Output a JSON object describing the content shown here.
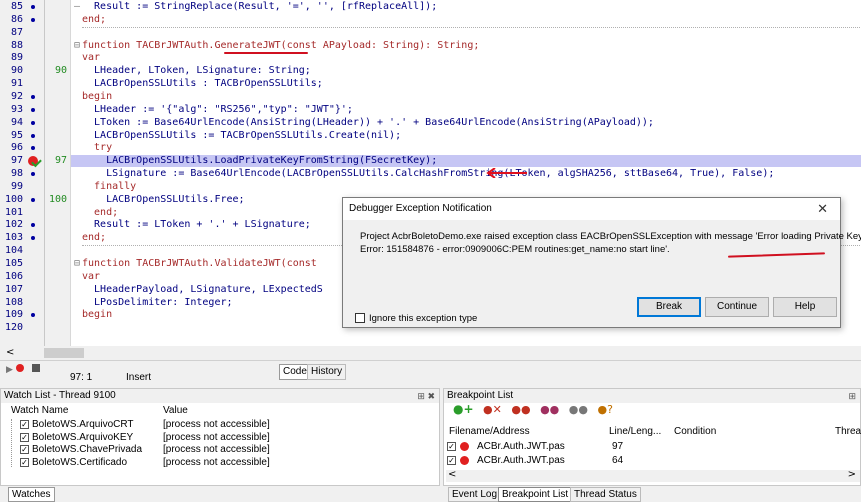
{
  "editor": {
    "lines": [
      {
        "num": "85",
        "bp": true,
        "fold": "–",
        "code": "  Result := StringReplace(Result, '=', '', [rfReplaceAll]);"
      },
      {
        "num": "86",
        "bp": true,
        "fold": "",
        "code": "end;"
      },
      {
        "num": "87",
        "bp": false,
        "fold": "",
        "code": ""
      },
      {
        "num": "88",
        "bp": false,
        "fold": "⊟",
        "code": "function TACBrJWTAuth.GenerateJWT(const APayload: String): String;"
      },
      {
        "num": "89",
        "bp": false,
        "fold": "",
        "code": "var"
      },
      {
        "num": "90",
        "bp": false,
        "fold": "",
        "code": "  LHeader, LToken, LSignature: String;",
        "num2": "90"
      },
      {
        "num": "91",
        "bp": false,
        "fold": "",
        "code": "  LACBrOpenSSLUtils : TACBrOpenSSLUtils;"
      },
      {
        "num": "92",
        "bp": true,
        "fold": "",
        "code": "begin"
      },
      {
        "num": "93",
        "bp": true,
        "fold": "",
        "code": "  LHeader := '{\"alg\": \"RS256\",\"typ\": \"JWT\"}';"
      },
      {
        "num": "94",
        "bp": true,
        "fold": "",
        "code": "  LToken := Base64UrlEncode(AnsiString(LHeader)) + '.' + Base64UrlEncode(AnsiString(APayload));"
      },
      {
        "num": "95",
        "bp": true,
        "fold": "",
        "code": "  LACBrOpenSSLUtils := TACBrOpenSSLUtils.Create(nil);"
      },
      {
        "num": "96",
        "bp": true,
        "fold": "",
        "code": "  try"
      },
      {
        "num": "97",
        "bp": false,
        "fold": "",
        "code": "    LACBrOpenSSLUtils.LoadPrivateKeyFromString(FSecretKey);",
        "num2": "97",
        "current": true
      },
      {
        "num": "98",
        "bp": true,
        "fold": "",
        "code": "    LSignature := Base64UrlEncode(LACBrOpenSSLUtils.CalcHashFromString(LToken, algSHA256, sttBase64, True), False);"
      },
      {
        "num": "99",
        "bp": false,
        "fold": "",
        "code": "  finally"
      },
      {
        "num": "100",
        "bp": true,
        "fold": "",
        "code": "    LACBrOpenSSLUtils.Free;",
        "num2": "100"
      },
      {
        "num": "101",
        "bp": false,
        "fold": "",
        "code": "  end;"
      },
      {
        "num": "102",
        "bp": true,
        "fold": "",
        "code": "  Result := LToken + '.' + LSignature;"
      },
      {
        "num": "103",
        "bp": true,
        "fold": "",
        "code": "end;"
      },
      {
        "num": "104",
        "bp": false,
        "fold": "",
        "code": ""
      },
      {
        "num": "105",
        "bp": false,
        "fold": "⊟",
        "code": "function TACBrJWTAuth.ValidateJWT(const"
      },
      {
        "num": "106",
        "bp": false,
        "fold": "",
        "code": "var"
      },
      {
        "num": "107",
        "bp": false,
        "fold": "",
        "code": "  LHeaderPayload, LSignature, LExpectedS"
      },
      {
        "num": "108",
        "bp": false,
        "fold": "",
        "code": "  LPosDelimiter: Integer;"
      },
      {
        "num": "109",
        "bp": true,
        "fold": "",
        "code": "begin"
      },
      {
        "num": "120",
        "bp": false,
        "fold": "",
        "code": ""
      }
    ]
  },
  "dialog": {
    "title": "Debugger Exception Notification",
    "close": "✕",
    "message1": "Project AcbrBoletoDemo.exe raised exception class EACBrOpenSSLException with message 'Error loading Private Key",
    "message2": "Error: 151584876 - error:0909006C:PEM routines:get_name:no start line'.",
    "checkbox_label": "Ignore this exception type",
    "break_label": "Break",
    "continue_label": "Continue",
    "help_label": "Help"
  },
  "status": {
    "position": "97: 1",
    "mode": "Insert",
    "tab_code": "Code",
    "tab_history": "History"
  },
  "watch": {
    "title": "Watch List - Thread 9100",
    "col_name": "Watch Name",
    "col_value": "Value",
    "rows": [
      {
        "name": "BoletoWS.ArquivoCRT",
        "value": "[process not accessible]"
      },
      {
        "name": "BoletoWS.ArquivoKEY",
        "value": "[process not accessible]"
      },
      {
        "name": "BoletoWS.ChavePrivada",
        "value": "[process not accessible]"
      },
      {
        "name": "BoletoWS.Certificado",
        "value": "[process not accessible]"
      }
    ],
    "tab": "Watches"
  },
  "breakpoints": {
    "title": "Breakpoint List",
    "col_file": "Filename/Address",
    "col_line": "Line/Leng...",
    "col_cond": "Condition",
    "col_thread": "Threa",
    "rows": [
      {
        "file": "ACBr.Auth.JWT.pas",
        "line": "97"
      },
      {
        "file": "ACBr.Auth.JWT.pas",
        "line": "64"
      }
    ],
    "tabs": [
      "Event Log",
      "Breakpoint List",
      "Thread Status"
    ]
  }
}
